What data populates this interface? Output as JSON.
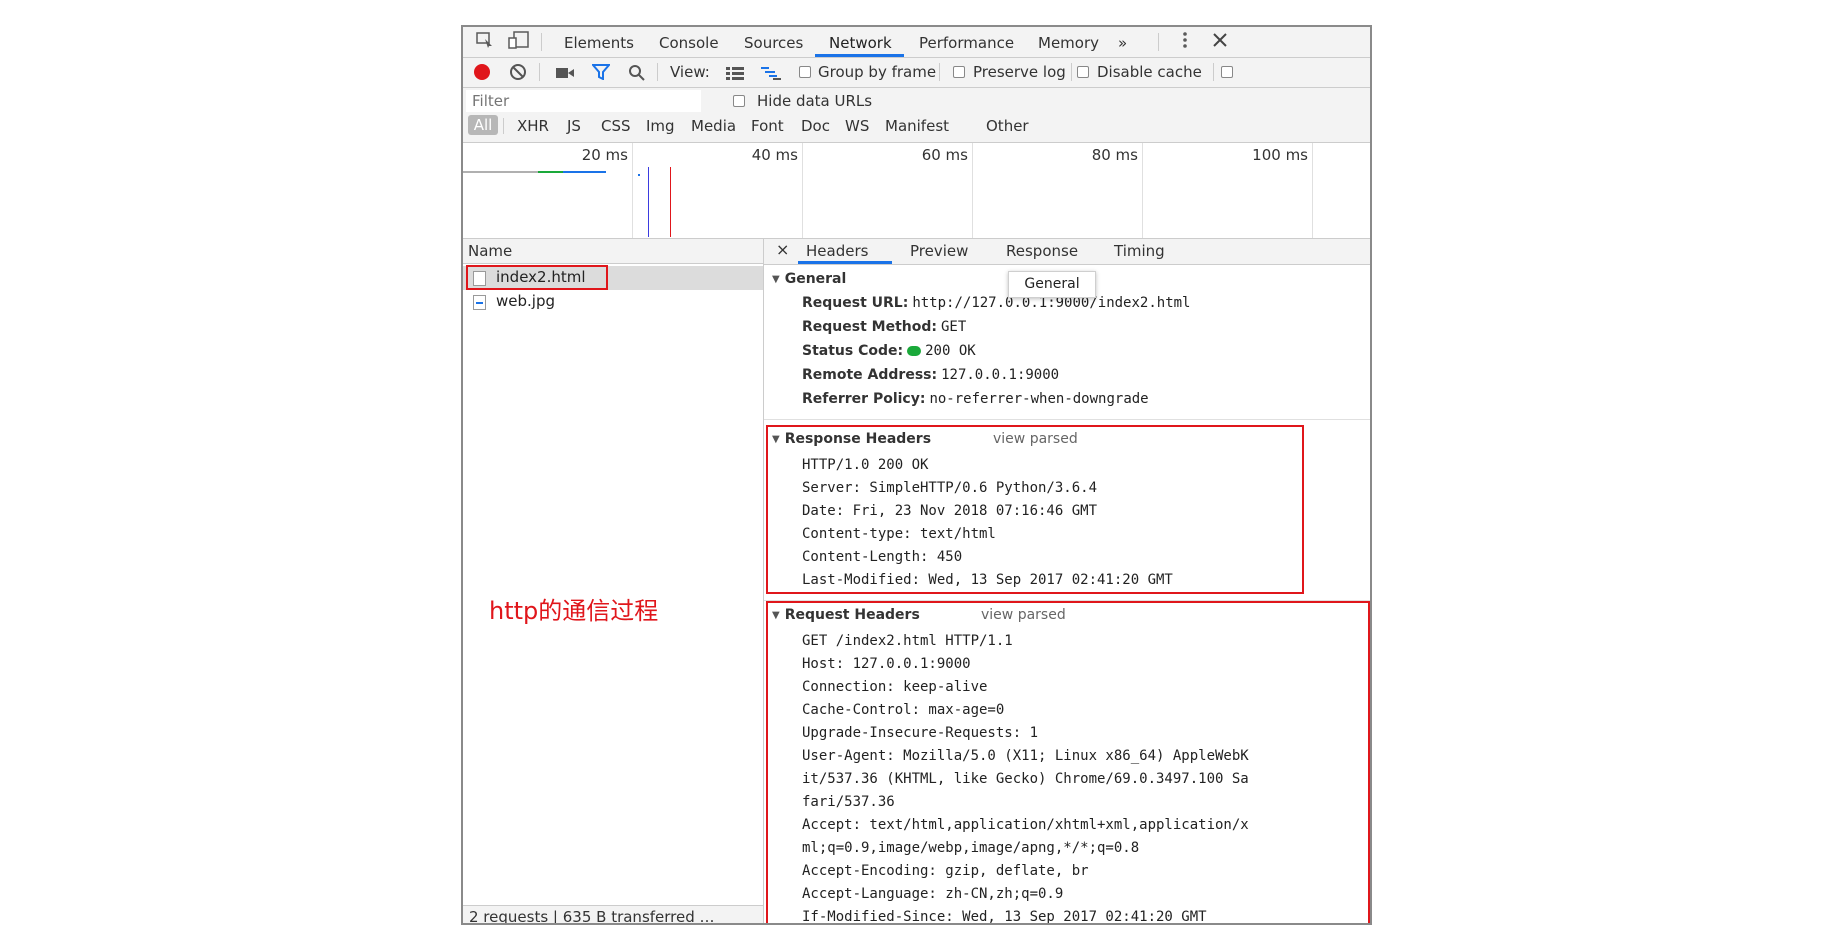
{
  "main_tabs": [
    "Elements",
    "Console",
    "Sources",
    "Network",
    "Performance",
    "Memory"
  ],
  "more_tabs": "»",
  "toolbar": {
    "view_label": "View:",
    "group_by_frame": "Group by frame",
    "preserve_log": "Preserve log",
    "disable_cache": "Disable cache"
  },
  "filter": {
    "placeholder": "Filter",
    "hide_data_urls": "Hide data URLs",
    "types": [
      "All",
      "XHR",
      "JS",
      "CSS",
      "Img",
      "Media",
      "Font",
      "Doc",
      "WS",
      "Manifest",
      "Other"
    ]
  },
  "overview": {
    "ticks": [
      "20 ms",
      "40 ms",
      "60 ms",
      "80 ms",
      "100 ms"
    ]
  },
  "requests": {
    "header": "Name",
    "files": [
      "index2.html",
      "web.jpg"
    ],
    "status": "2 requests  |  635 B transferred  …"
  },
  "detail_tabs": {
    "close": "×",
    "tabs": [
      "Headers",
      "Preview",
      "Response",
      "Timing"
    ]
  },
  "tooltip": "General",
  "general": {
    "title": "General",
    "rows": [
      {
        "key": "Request URL:",
        "value": "http://127.0.0.1:9000/index2.html"
      },
      {
        "key": "Request Method:",
        "value": "GET"
      },
      {
        "key": "Status Code:",
        "value": "200 OK"
      },
      {
        "key": "Remote Address:",
        "value": "127.0.0.1:9000"
      },
      {
        "key": "Referrer Policy:",
        "value": "no-referrer-when-downgrade"
      }
    ]
  },
  "response_headers": {
    "title": "Response Headers",
    "view_parsed": "view parsed",
    "lines": [
      "HTTP/1.0 200 OK",
      "Server: SimpleHTTP/0.6 Python/3.6.4",
      "Date: Fri, 23 Nov 2018 07:16:46 GMT",
      "Content-type: text/html",
      "Content-Length: 450",
      "Last-Modified: Wed, 13 Sep 2017 02:41:20 GMT"
    ]
  },
  "request_headers": {
    "title": "Request Headers",
    "view_parsed": "view parsed",
    "lines": [
      "GET /index2.html HTTP/1.1",
      "Host: 127.0.0.1:9000",
      "Connection: keep-alive",
      "Cache-Control: max-age=0",
      "Upgrade-Insecure-Requests: 1",
      "User-Agent: Mozilla/5.0 (X11; Linux x86_64) AppleWebK",
      "it/537.36 (KHTML, like Gecko) Chrome/69.0.3497.100 Sa",
      "fari/537.36",
      "Accept: text/html,application/xhtml+xml,application/x",
      "ml;q=0.9,image/webp,image/apng,*/*;q=0.8",
      "Accept-Encoding: gzip, deflate, br",
      "Accept-Language: zh-CN,zh;q=0.9",
      "If-Modified-Since: Wed, 13 Sep 2017 02:41:20 GMT"
    ]
  },
  "annotation": "http的通信过程",
  "colors": {
    "accent": "#1a73e8",
    "record_red": "#e0161b",
    "status_green": "#1aa93a",
    "annotation_red": "#e0161b"
  }
}
